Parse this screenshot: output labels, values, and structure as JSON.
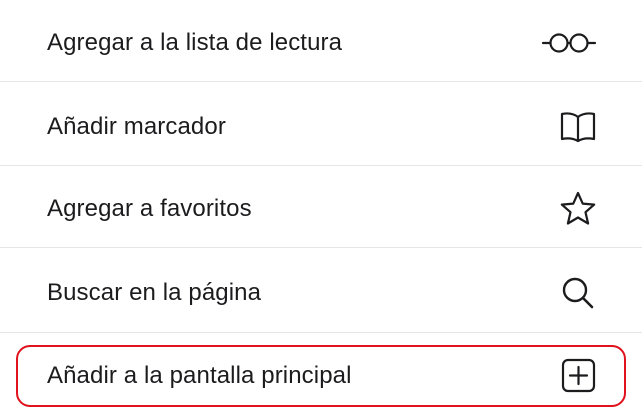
{
  "menu": {
    "items": [
      {
        "label": "Agregar a la lista de lectura",
        "icon": "reading-glasses-icon"
      },
      {
        "label": "Añadir marcador",
        "icon": "open-book-icon"
      },
      {
        "label": "Agregar a favoritos",
        "icon": "star-icon"
      },
      {
        "label": "Buscar en la página",
        "icon": "magnifying-glass-icon"
      },
      {
        "label": "Añadir a la pantalla principal",
        "icon": "plus-square-icon"
      }
    ]
  },
  "colors": {
    "highlight": "#e0121d",
    "text": "#1c1c1e",
    "divider": "#e6e6e8"
  }
}
